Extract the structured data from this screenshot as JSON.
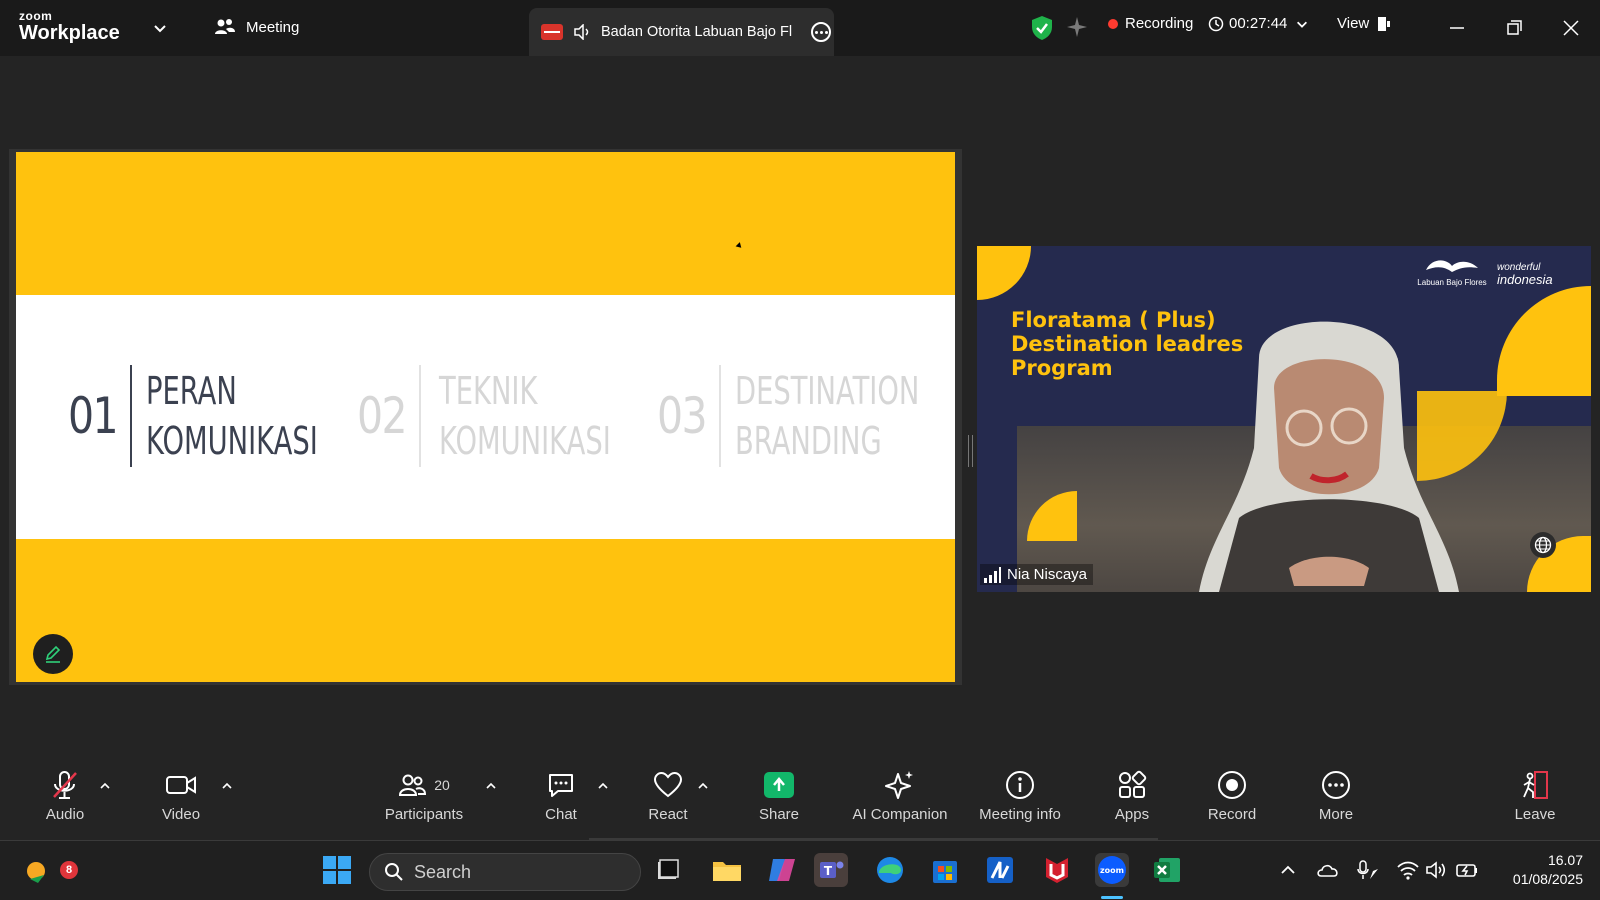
{
  "app": {
    "brand_small": "zoom",
    "brand_big": "Workplace",
    "meeting_label": "Meeting"
  },
  "share_tab": {
    "title": "Badan Otorita Labuan Bajo Fl"
  },
  "status": {
    "recording_label": "Recording",
    "timer": "00:27:44",
    "view_label": "View"
  },
  "slide": {
    "sections": [
      {
        "number": "01",
        "line1": "PERAN",
        "line2": "KOMUNIKASI",
        "active": true
      },
      {
        "number": "02",
        "line1": "TEKNIK",
        "line2": "KOMUNIKASI",
        "active": false
      },
      {
        "number": "03",
        "line1": "DESTINATION",
        "line2": "BRANDING",
        "active": false
      }
    ]
  },
  "participant": {
    "name": "Nia Niscaya",
    "promo_line1": "Floratama ( Plus)",
    "promo_line2": "Destination leadres",
    "promo_line3": "Program",
    "logo_lbf": "Labuan Bajo Flores",
    "logo_wi_1": "wonderful",
    "logo_wi_2": "indonesia"
  },
  "toolbar": {
    "audio": "Audio",
    "video": "Video",
    "participants": "Participants",
    "participants_count": "20",
    "chat": "Chat",
    "react": "React",
    "share": "Share",
    "ai_companion": "AI Companion",
    "meeting_info": "Meeting info",
    "apps": "Apps",
    "record": "Record",
    "more": "More",
    "leave": "Leave"
  },
  "taskbar": {
    "search_placeholder": "Search",
    "notification_badge": "8",
    "time": "16.07",
    "date": "01/08/2025"
  },
  "colors": {
    "slide_yellow": "#ffc20e",
    "slide_text_active": "#3b4150",
    "recording_red": "#ff3b30",
    "share_green": "#12b76a"
  }
}
